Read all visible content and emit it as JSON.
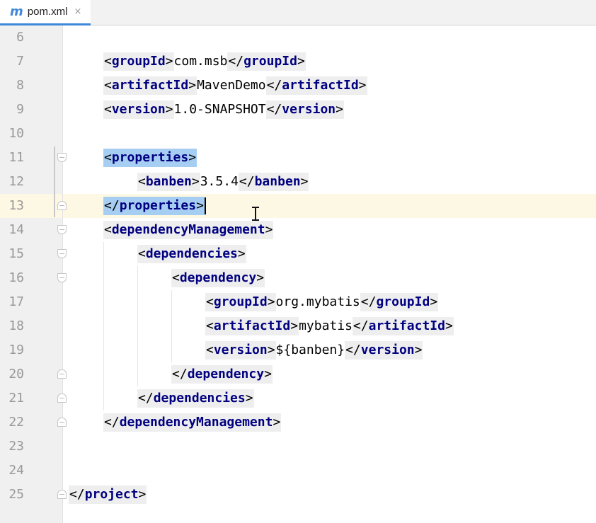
{
  "tab": {
    "icon": "m",
    "icon_name": "maven-file-icon",
    "label": "pom.xml",
    "close": "×"
  },
  "colors": {
    "accent": "#3f87d9",
    "tag_name": "#000080",
    "selection": "#a6cef3",
    "caret_line": "#fdf8e3",
    "line_number": "#999999"
  },
  "editor": {
    "caret_line": 13,
    "lines": [
      {
        "n": "6"
      },
      {
        "n": "7",
        "open": "groupId",
        "text": "com.msb",
        "close": "groupId"
      },
      {
        "n": "8",
        "open": "artifactId",
        "text": "MavenDemo",
        "close": "artifactId"
      },
      {
        "n": "9",
        "open": "version",
        "text": "1.0-SNAPSHOT",
        "close": "version"
      },
      {
        "n": "10"
      },
      {
        "n": "11",
        "open": "properties"
      },
      {
        "n": "12",
        "open": "banben",
        "text": "3.5.4",
        "close": "banben"
      },
      {
        "n": "13",
        "close": "properties"
      },
      {
        "n": "14",
        "open": "dependencyManagement"
      },
      {
        "n": "15",
        "open": "dependencies"
      },
      {
        "n": "16",
        "open": "dependency"
      },
      {
        "n": "17",
        "open": "groupId",
        "text": "org.mybatis",
        "close": "groupId"
      },
      {
        "n": "18",
        "open": "artifactId",
        "text": "mybatis",
        "close": "artifactId"
      },
      {
        "n": "19",
        "open": "version",
        "text": "${banben}",
        "close": "version"
      },
      {
        "n": "20",
        "close": "dependency"
      },
      {
        "n": "21",
        "close": "dependencies"
      },
      {
        "n": "22",
        "close": "dependencyManagement"
      },
      {
        "n": "23"
      },
      {
        "n": "24"
      },
      {
        "n": "25",
        "close": "project"
      }
    ]
  }
}
